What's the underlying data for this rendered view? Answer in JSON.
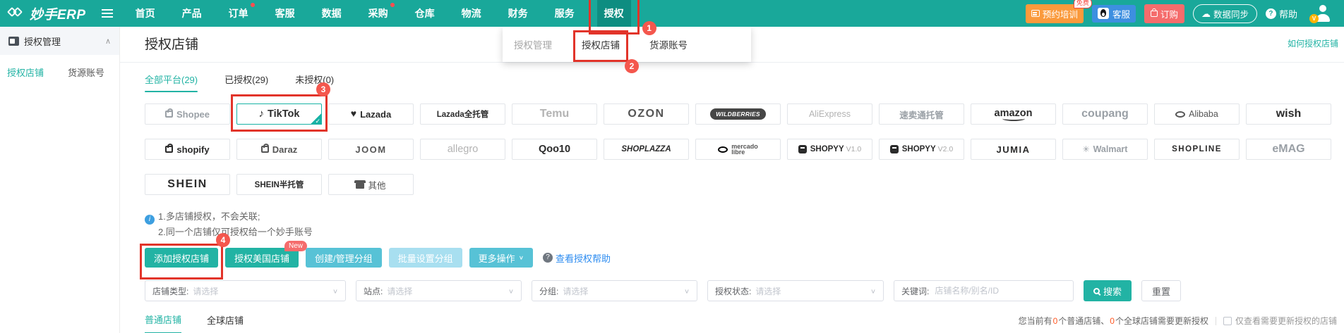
{
  "colors": {
    "accent_teal": "#19a89a",
    "button_teal": "#22b3a4",
    "annotation_red": "#e2342a",
    "step_badge_red": "#f4574d",
    "notification_red": "#ff4d4f",
    "train_orange": "#fa9a3c",
    "qq_blue": "#3d8fe0",
    "order_red": "#f56c6c",
    "warn_orange": "#ff5722"
  },
  "navbar": {
    "brand": "妙手ERP",
    "items": [
      {
        "label": "首页"
      },
      {
        "label": "产品"
      },
      {
        "label": "订单",
        "dot": true
      },
      {
        "label": "客服"
      },
      {
        "label": "数据"
      },
      {
        "label": "采购",
        "dot": true
      },
      {
        "label": "仓库"
      },
      {
        "label": "物流"
      },
      {
        "label": "财务"
      },
      {
        "label": "服务"
      }
    ],
    "auth_item": "授权",
    "right": {
      "train": "预约培训",
      "train_badge": "免费",
      "qq": "客服",
      "order": "订购",
      "sync": "数据同步",
      "help": "帮助",
      "vip": "V"
    }
  },
  "dropdown": {
    "items": [
      {
        "label": "授权管理",
        "cls": "muted"
      },
      {
        "label": "授权店铺",
        "cls": "red-frame frame-dd current",
        "step": "2"
      },
      {
        "label": "货源账号"
      }
    ]
  },
  "sidebar": {
    "header": "授权管理",
    "items": [
      {
        "label": "授权店铺",
        "cls": "active"
      },
      {
        "label": "货源账号"
      }
    ]
  },
  "main": {
    "title": "授权店铺",
    "help_link": "如何授权店铺",
    "tabs": [
      {
        "label": "全部平台(29)",
        "cls": "active"
      },
      {
        "label": "已授权(29)"
      },
      {
        "label": "未授权(0)"
      }
    ],
    "notes": [
      "1.多店铺授权，不会关联;",
      "2.同一个店铺仅可授权给一个妙手账号"
    ],
    "actions": {
      "add": "添加授权店铺",
      "us_store": "授权美国店铺",
      "us_badge": "New",
      "group": "创建/管理分组",
      "batch": "批量设置分组",
      "more": "更多操作",
      "help": "查看授权帮助"
    },
    "filters": {
      "selects": [
        {
          "label": "店铺类型:",
          "placeholder": "请选择",
          "cls": "w-lg"
        },
        {
          "label": "站点:",
          "placeholder": "请选择"
        },
        {
          "label": "分组:",
          "placeholder": "请选择"
        },
        {
          "label": "授权状态:",
          "placeholder": "请选择",
          "cls": "w-md"
        }
      ],
      "keyword_label": "关键词:",
      "keyword_placeholder": "店铺名称/别名/ID",
      "search": "搜索",
      "reset": "重置"
    },
    "bottom_tabs": [
      {
        "label": "普通店铺",
        "cls": "active"
      },
      {
        "label": "全球店铺"
      }
    ],
    "summary": {
      "t1": "您当前有",
      "n1": "0",
      "t2": "个普通店铺、",
      "n2": "0",
      "t3": "个全球店铺需要更新授权",
      "checkbox": "仅查看需要更新授权的店铺"
    }
  },
  "platforms": {
    "row1": [
      {
        "name": "Shopee",
        "icon": "bag",
        "cls": "g b"
      },
      {
        "name": "TikTok",
        "icon": "note",
        "cls": "d b lg red-frame frame-tile",
        "highlight": true,
        "step": "3"
      },
      {
        "name": "Lazada",
        "icon": "heart",
        "cls": "d b"
      },
      {
        "name": "Lazada全托管",
        "cls": "d b sm"
      },
      {
        "name": "Temu",
        "cls": "g2 b xl"
      },
      {
        "name": "OZON",
        "cls": "d2 b xl sp"
      },
      {
        "name": "WILDBERRIES",
        "cls": "wb"
      },
      {
        "name": "AliExpress",
        "cls": "g2 md"
      },
      {
        "name": "速卖通托管",
        "cls": "g b md"
      },
      {
        "name": "amazon",
        "cls": "d b lg amz"
      },
      {
        "name": "coupang",
        "cls": "g b xl"
      },
      {
        "name": "Alibaba",
        "icon": "oval",
        "cls": "d2 md"
      },
      {
        "name": "wish",
        "cls": "d b xl"
      }
    ],
    "row2": [
      {
        "name": "shopify",
        "icon": "bag",
        "cls": "d b"
      },
      {
        "name": "Daraz",
        "icon": "bag",
        "cls": "d2 b"
      },
      {
        "name": "JOOM",
        "cls": "d2 b sp"
      },
      {
        "name": "allegro",
        "cls": "g2 lg"
      },
      {
        "name": "Qoo10",
        "cls": "d b lg"
      },
      {
        "name": "SHOPLAZZA",
        "cls": "d b it sm"
      },
      {
        "name": "mercado\nlibre",
        "icon": "oval",
        "cls": "ml"
      },
      {
        "name": "SHOPYY",
        "sub": "V1.0",
        "icon": "app",
        "cls": "d b sm"
      },
      {
        "name": "SHOPYY",
        "sub": "V2.0",
        "icon": "app",
        "cls": "d b sm"
      },
      {
        "name": "JUMIA",
        "cls": "d b sp"
      },
      {
        "name": "Walmart",
        "icon": "spark",
        "cls": "g b md"
      },
      {
        "name": "SHOPLINE",
        "cls": "d b sm sp"
      },
      {
        "name": "eMAG",
        "cls": "g b xl"
      }
    ],
    "row3": [
      {
        "name": "SHEIN",
        "cls": "d b xl sp"
      },
      {
        "name": "SHEIN半托管",
        "cls": "d b sm"
      },
      {
        "name": "其他",
        "icon": "store",
        "cls": "d2 md"
      }
    ]
  },
  "annotations": {
    "step1": "1",
    "step2": "2",
    "step3": "3",
    "step4": "4"
  }
}
